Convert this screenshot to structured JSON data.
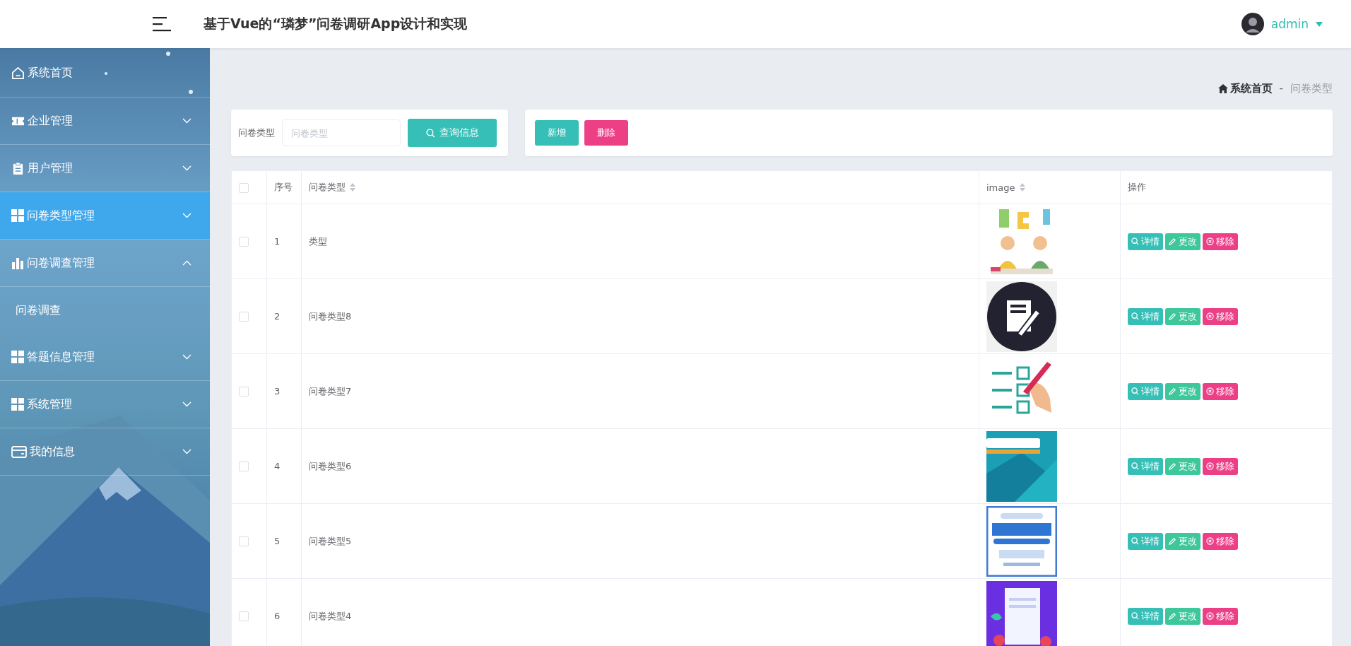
{
  "header": {
    "title": "基于Vue的“璘梦”问卷调研App设计和实现",
    "user": "admin"
  },
  "sidebar": {
    "items": [
      {
        "label": "系统首页",
        "kind": "link",
        "selected": false
      },
      {
        "label": "企业管理",
        "kind": "menu",
        "selected": false,
        "expanded": false
      },
      {
        "label": "用户管理",
        "kind": "menu",
        "selected": false,
        "expanded": false
      },
      {
        "label": "问卷类型管理",
        "kind": "menu",
        "selected": true,
        "expanded": false
      },
      {
        "label": "问卷调查管理",
        "kind": "menu",
        "selected": false,
        "expanded": true,
        "children": [
          {
            "label": "问卷调查",
            "selected": false
          }
        ]
      },
      {
        "label": "答题信息管理",
        "kind": "menu",
        "selected": false,
        "expanded": false
      },
      {
        "label": "系统管理",
        "kind": "menu",
        "selected": false,
        "expanded": false
      },
      {
        "label": "我的信息",
        "kind": "menu",
        "selected": false,
        "expanded": false
      }
    ]
  },
  "breadcrumb": {
    "home": "系统首页",
    "separator": "-",
    "current": "问卷类型"
  },
  "search": {
    "label": "问卷类型",
    "placeholder": "问卷类型",
    "button": "查询信息"
  },
  "actions": [
    {
      "label": "新增",
      "kind": "add"
    },
    {
      "label": "删除",
      "kind": "delete"
    }
  ],
  "table": {
    "select_all": {
      "checked": false
    },
    "columns": [
      {
        "label": "序号",
        "sortable": false
      },
      {
        "label": "问卷类型",
        "sortable": true
      },
      {
        "label": "image",
        "sortable": true
      },
      {
        "label": "操作",
        "sortable": false
      }
    ],
    "rows": [
      {
        "checked": false,
        "index": "1",
        "type": "类型",
        "image": {
          "kind": "picture"
        },
        "actions": [
          {
            "label": "详情",
            "kind": "detail"
          },
          {
            "label": "更改",
            "kind": "edit"
          },
          {
            "label": "移除",
            "kind": "remove"
          }
        ]
      },
      {
        "checked": false,
        "index": "2",
        "type": "问卷类型8",
        "image": {
          "kind": "picture"
        },
        "actions": [
          {
            "label": "详情",
            "kind": "detail"
          },
          {
            "label": "更改",
            "kind": "edit"
          },
          {
            "label": "移除",
            "kind": "remove"
          }
        ]
      },
      {
        "checked": false,
        "index": "3",
        "type": "问卷类型7",
        "image": {
          "kind": "picture"
        },
        "actions": [
          {
            "label": "详情",
            "kind": "detail"
          },
          {
            "label": "更改",
            "kind": "edit"
          },
          {
            "label": "移除",
            "kind": "remove"
          }
        ]
      },
      {
        "checked": false,
        "index": "4",
        "type": "问卷类型6",
        "image": {
          "kind": "picture"
        },
        "actions": [
          {
            "label": "详情",
            "kind": "detail"
          },
          {
            "label": "更改",
            "kind": "edit"
          },
          {
            "label": "移除",
            "kind": "remove"
          }
        ]
      },
      {
        "checked": false,
        "index": "5",
        "type": "问卷类型5",
        "image": {
          "kind": "picture"
        },
        "actions": [
          {
            "label": "详情",
            "kind": "detail"
          },
          {
            "label": "更改",
            "kind": "edit"
          },
          {
            "label": "移除",
            "kind": "remove"
          }
        ]
      },
      {
        "checked": false,
        "index": "6",
        "type": "问卷类型4",
        "image": {
          "kind": "picture"
        },
        "actions": [
          {
            "label": "详情",
            "kind": "detail"
          },
          {
            "label": "更改",
            "kind": "edit"
          },
          {
            "label": "移除",
            "kind": "remove"
          }
        ]
      }
    ]
  }
}
